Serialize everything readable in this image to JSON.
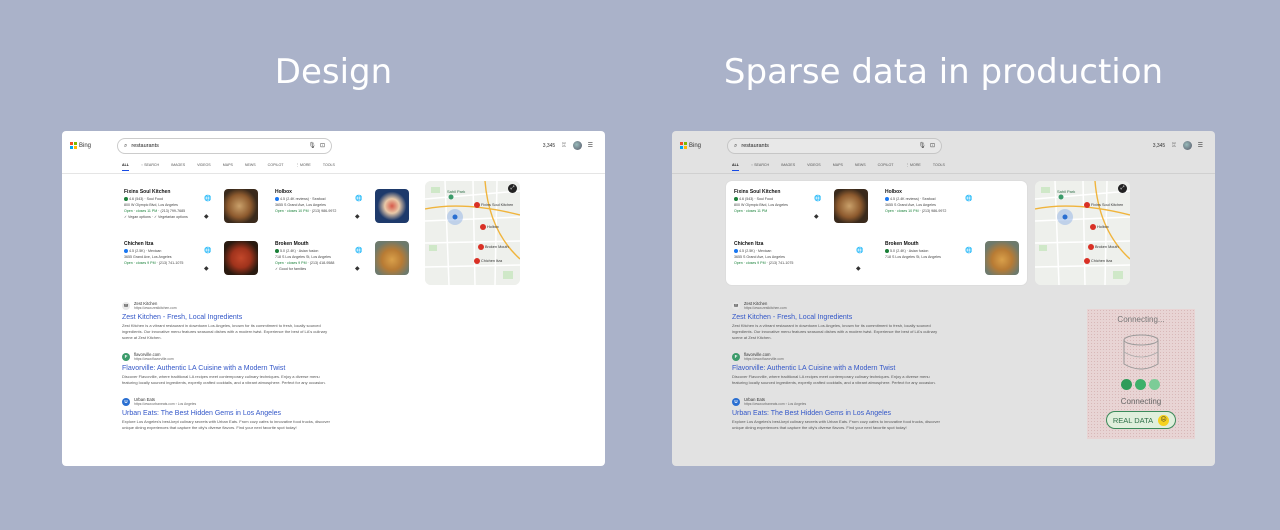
{
  "titles": {
    "design": "Design",
    "sparse": "Sparse data in production"
  },
  "browser": {
    "logo": "Bing",
    "query": "restaurants",
    "points": "3,345",
    "tabs": [
      "ALL",
      "SEARCH",
      "IMAGES",
      "VIDEOS",
      "MAPS",
      "NEWS",
      "COPILOT",
      "MORE",
      "TOOLS"
    ]
  },
  "colors": {
    "accent": "#174ae4",
    "link": "#3357c8",
    "open": "#188038",
    "pin": "#d93025",
    "real_data_border": "#3b8a5a"
  },
  "design": {
    "businesses": [
      {
        "name": "Fixins Soul Kitchen",
        "rating": "4.6 (543)",
        "category": "Soul Food",
        "address": "800 W Olympic Blvd, Los Angeles",
        "hours": "Open · closes 11 PM",
        "phone": "(213) 799-7685",
        "extra": "✓ Vegan options · ✓ Vegetarian options"
      },
      {
        "name": "Holbox",
        "rating": "4.5 (2.4K reviews)",
        "category": "Seafood",
        "address": "3655 S Grand Ave, Los Angeles",
        "hours": "Open · closes 10 PM",
        "phone": "(213) 986-9972",
        "extra": ""
      },
      {
        "name": "Chichen Itza",
        "rating": "4.5 (2.5K)",
        "category": "Mexican",
        "address": "3655 Grand Ave, Los Angeles",
        "hours": "Open · closes 9 PM",
        "phone": "(213) 741-1075",
        "extra": ""
      },
      {
        "name": "Broken Mouth",
        "rating": "5.0 (2.4K)",
        "category": "Asian fusion",
        "address": "718 S Los Angeles St, Los Angeles",
        "hours": "Open · closes 9 PM",
        "phone": "(213) 418-9588",
        "extra": "✓ Good for families"
      }
    ]
  },
  "sparse": {
    "businesses": [
      {
        "name": "Fixins Soul Kitchen",
        "rating": "4.6 (543)",
        "category": "Soul Food",
        "address": "800 W Olympic Blvd, Los Angeles",
        "hours": "Open · closes 11 PM",
        "phone": "",
        "extra": ""
      },
      {
        "name": "Holbox",
        "rating": "4.5 (2.4K reviews)",
        "category": "Seafood",
        "address": "3655 S Grand Ave, Los Angeles",
        "hours": "Open · closes 10 PM",
        "phone": "(213) 986-9972",
        "extra": ""
      },
      {
        "name": "Chichen Itza",
        "rating": "4.5 (2.5K)",
        "category": "Mexican",
        "address": "3655 S Grand Ave, Los Angeles",
        "hours": "Open · closes 9 PM",
        "phone": "(213) 741-1075",
        "extra": ""
      },
      {
        "name": "Broken Mouth",
        "rating": "5.0 (2.4K)",
        "category": "Asian fusion",
        "address": "718 S Los Angeles St, Los Angeles",
        "hours": "",
        "phone": "",
        "extra": ""
      }
    ]
  },
  "map": {
    "labels": [
      "Sahil Park",
      "Fixins Soul Kitchen",
      "Holbox",
      "Broken Mouth",
      "Chichen Itza"
    ]
  },
  "results": [
    {
      "site": "Zest Kitchen",
      "url": "https://www.zestkitchen.com",
      "title": "Zest Kitchen - Fresh, Local Ingredients",
      "desc": "Zest Kitchen is a vibrant restaurant in downtown Los Angeles, known for its commitment to fresh, locally sourced ingredients. Our innovative menu features seasonal dishes with a modern twist. Experience the best of LA's culinary scene at Zest Kitchen."
    },
    {
      "site": "flavorville.com",
      "url": "https://www.flavorville.com",
      "title": "Flavorville: Authentic LA Cuisine with a Modern Twist",
      "desc": "Discover Flavorville, where traditional LA recipes meet contemporary culinary techniques. Enjoy a diverse menu featuring locally sourced ingredients, expertly crafted cocktails, and a vibrant atmosphere. Perfect for any occasion."
    },
    {
      "site": "Urban Eats",
      "url": "https://www.urbaneats.com › Los Angeles",
      "title": "Urban Eats: The Best Hidden Gems in Los Angeles",
      "desc": "Explore Los Angeles's best-kept culinary secrets with Urban Eats. From cozy cafes to innovative food trucks, discover unique dining experiences that capture the city's diverse flavors. Find your next favorite spot today!"
    }
  ],
  "connecting": {
    "top": "Connecting...",
    "label": "Connecting",
    "button": "REAL DATA",
    "dot_colors": [
      "#2f9c5a",
      "#3cb06a",
      "#7ccc97"
    ]
  }
}
